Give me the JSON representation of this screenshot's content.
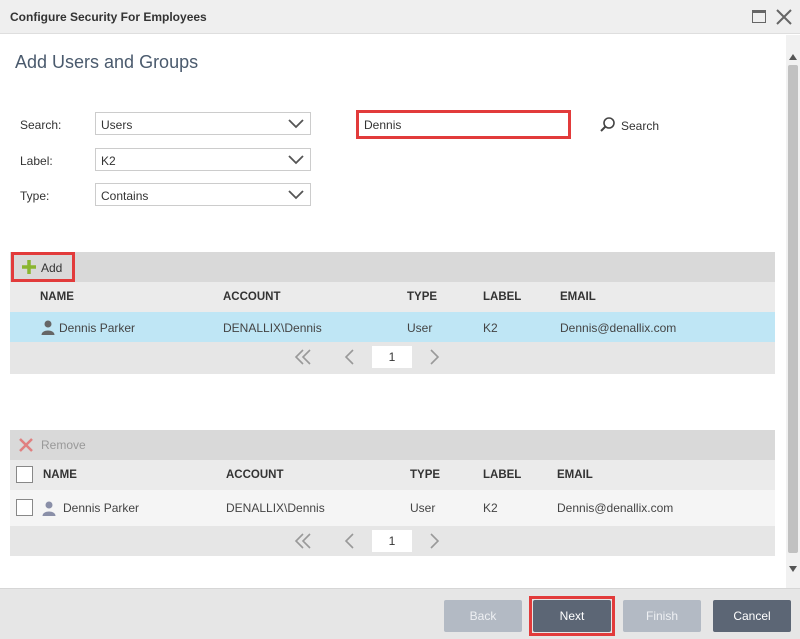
{
  "window": {
    "title": "Configure Security For Employees"
  },
  "page": {
    "title": "Add Users and Groups"
  },
  "form": {
    "search": {
      "label": "Search:",
      "value": "Users"
    },
    "label": {
      "label": "Label:",
      "value": "K2"
    },
    "type": {
      "label": "Type:",
      "value": "Contains"
    },
    "query": "Dennis",
    "search_button": "Search"
  },
  "results": {
    "add_label": "Add",
    "columns": [
      "NAME",
      "ACCOUNT",
      "TYPE",
      "LABEL",
      "EMAIL"
    ],
    "rows": [
      {
        "name": "Dennis Parker",
        "account": "DENALLIX\\Dennis",
        "type": "User",
        "label": "K2",
        "email": "Dennis@denallix.com",
        "selected": true
      }
    ],
    "page": "1"
  },
  "selected": {
    "remove_label": "Remove",
    "columns": [
      "NAME",
      "ACCOUNT",
      "TYPE",
      "LABEL",
      "EMAIL"
    ],
    "rows": [
      {
        "name": "Dennis Parker",
        "account": "DENALLIX\\Dennis",
        "type": "User",
        "label": "K2",
        "email": "Dennis@denallix.com"
      }
    ],
    "page": "1"
  },
  "footer": {
    "back": "Back",
    "next": "Next",
    "finish": "Finish",
    "cancel": "Cancel"
  },
  "colors": {
    "accent_red": "#e23b3b",
    "selected_row": "#bfe6f5",
    "title_blue": "#4a5a6d",
    "add_green": "#8ab530"
  },
  "icons": [
    "maximize-icon",
    "close-icon",
    "chevron-down-icon",
    "search-icon",
    "plus-icon",
    "remove-x-icon",
    "user-icon",
    "first-page-icon",
    "prev-page-icon",
    "next-page-icon"
  ]
}
